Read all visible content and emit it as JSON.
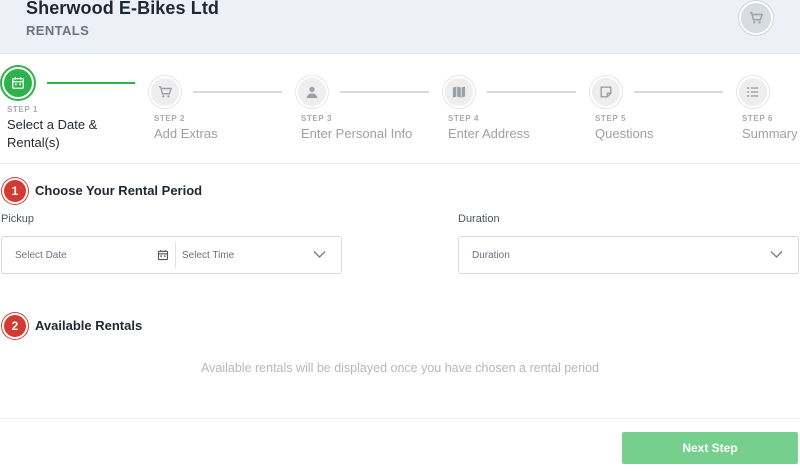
{
  "header": {
    "company": "Sherwood E-Bikes Ltd",
    "subtitle": "RENTALS",
    "cart_icon": "cart-icon"
  },
  "steps": [
    {
      "num": "STEP 1",
      "label": "Select a Date & Rental(s)",
      "icon": "calendar-icon",
      "state": "active"
    },
    {
      "num": "STEP 2",
      "label": "Add Extras",
      "icon": "cart-icon",
      "state": "pending"
    },
    {
      "num": "STEP 3",
      "label": "Enter Personal Info",
      "icon": "user-icon",
      "state": "pending"
    },
    {
      "num": "STEP 4",
      "label": "Enter Address",
      "icon": "map-icon",
      "state": "pending"
    },
    {
      "num": "STEP 5",
      "label": "Questions",
      "icon": "note-icon",
      "state": "pending"
    },
    {
      "num": "STEP 6",
      "label": "Summary",
      "icon": "list-icon",
      "state": "pending"
    }
  ],
  "rental_period": {
    "badge": "1",
    "title": "Choose Your Rental Period",
    "pickup_label": "Pickup",
    "date_placeholder": "Select Date",
    "time_placeholder": "Select Time",
    "duration_label": "Duration",
    "duration_placeholder": "Duration"
  },
  "available": {
    "badge": "2",
    "title": "Available Rentals",
    "message": "Available rentals will be displayed once you have chosen a rental period"
  },
  "footer": {
    "next_label": "Next Step"
  },
  "colors": {
    "accent_green": "#2cb34a",
    "badge_red": "#d23a32",
    "next_button": "#76cf8d",
    "header_bg": "#edf0f6"
  }
}
